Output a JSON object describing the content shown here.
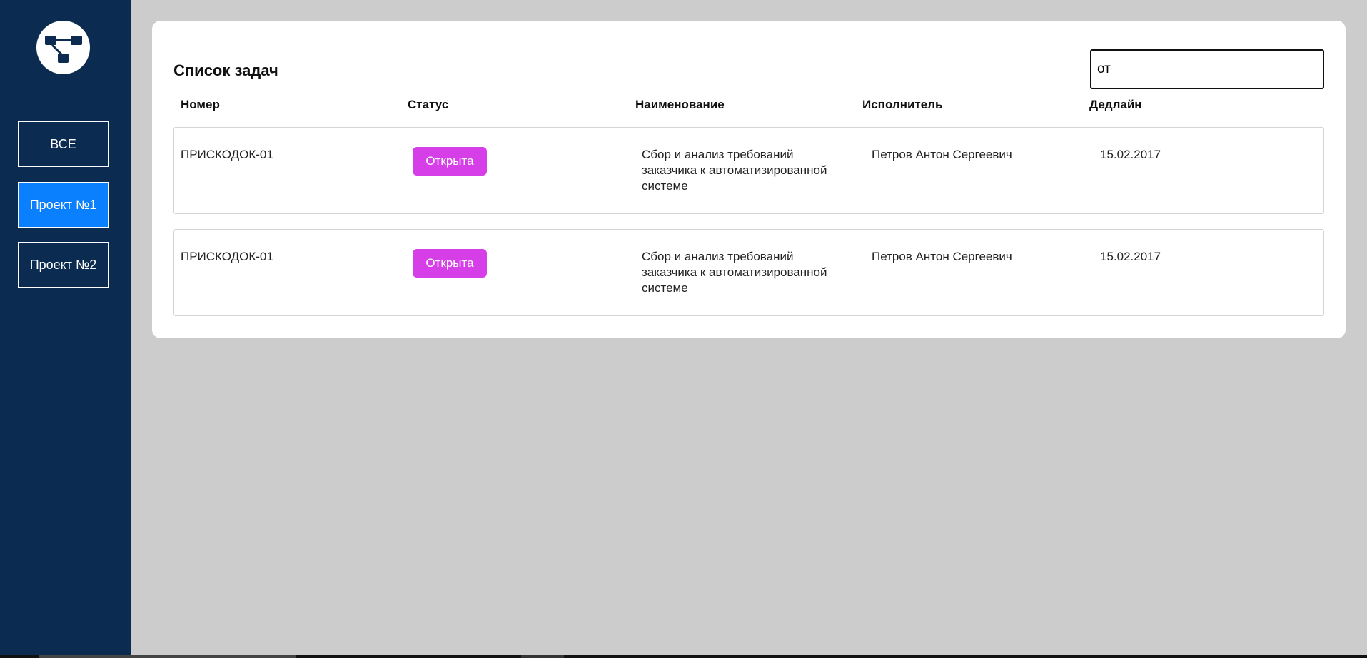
{
  "sidebar": {
    "logo_icon": "hierarchy-icon",
    "items": [
      {
        "label": "ВСЕ",
        "active": false
      },
      {
        "label": "Проект №1",
        "active": true
      },
      {
        "label": "Проект №2",
        "active": false
      }
    ]
  },
  "main": {
    "title": "Список задач",
    "search": {
      "value": "от",
      "placeholder": ""
    },
    "columns": [
      "Номер",
      "Статус",
      "Наименование",
      "Исполнитель",
      "Дедлайн"
    ],
    "rows": [
      {
        "number": "ПРИСКОДОК-01",
        "status": "Открыта",
        "name": "Сбор и анализ требований заказчика к автоматизированной системе",
        "executor": "Петров Антон Сергеевич",
        "deadline": "15.02.2017"
      },
      {
        "number": "ПРИСКОДОК-01",
        "status": "Открыта",
        "name": "Сбор и анализ требований заказчика к автоматизированной системе",
        "executor": "Петров Антон Сергеевич",
        "deadline": "15.02.2017"
      }
    ]
  },
  "colors": {
    "sidebar_bg": "#0b2c50",
    "active_nav": "#0a80ff",
    "status_badge": "#d63ee8",
    "page_bg": "#cccccc"
  }
}
